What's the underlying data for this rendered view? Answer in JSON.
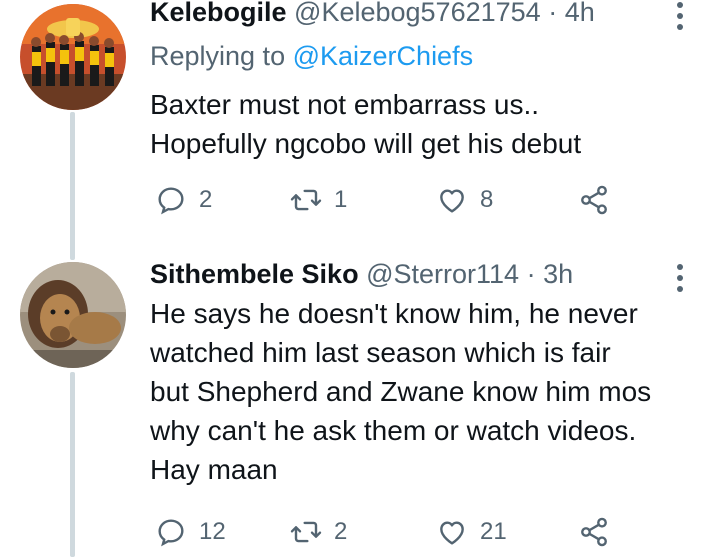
{
  "tweets": [
    {
      "display_name": "Kelebogile",
      "handle": "@Kelebog57621754",
      "separator": "·",
      "time": "4h",
      "replying_prefix": "Replying to",
      "replying_handle": "@KaizerChiefs",
      "lines": [
        "Baxter must not embarrass us..",
        "Hopefully ngcobo will get his debut"
      ],
      "replies": "2",
      "retweets": "1",
      "likes": "8"
    },
    {
      "display_name": "Sithembele Siko",
      "handle": "@Sterror114",
      "separator": "·",
      "time": "3h",
      "lines": [
        "He says he doesn't know him, he never",
        "watched him last season which is fair",
        "but Shepherd and Zwane know him mos",
        "why can't he ask them or watch videos.",
        "Hay maan"
      ],
      "replies": "12",
      "retweets": "2",
      "likes": "21"
    }
  ],
  "icons": {
    "reply": "reply-icon",
    "retweet": "retweet-icon",
    "like": "heart-icon",
    "share": "share-icon",
    "more": "more-options-icon"
  },
  "colors": {
    "link": "#1d9bf0",
    "muted": "#536471",
    "text": "#0f1419",
    "thread_line": "#cfd9de"
  }
}
